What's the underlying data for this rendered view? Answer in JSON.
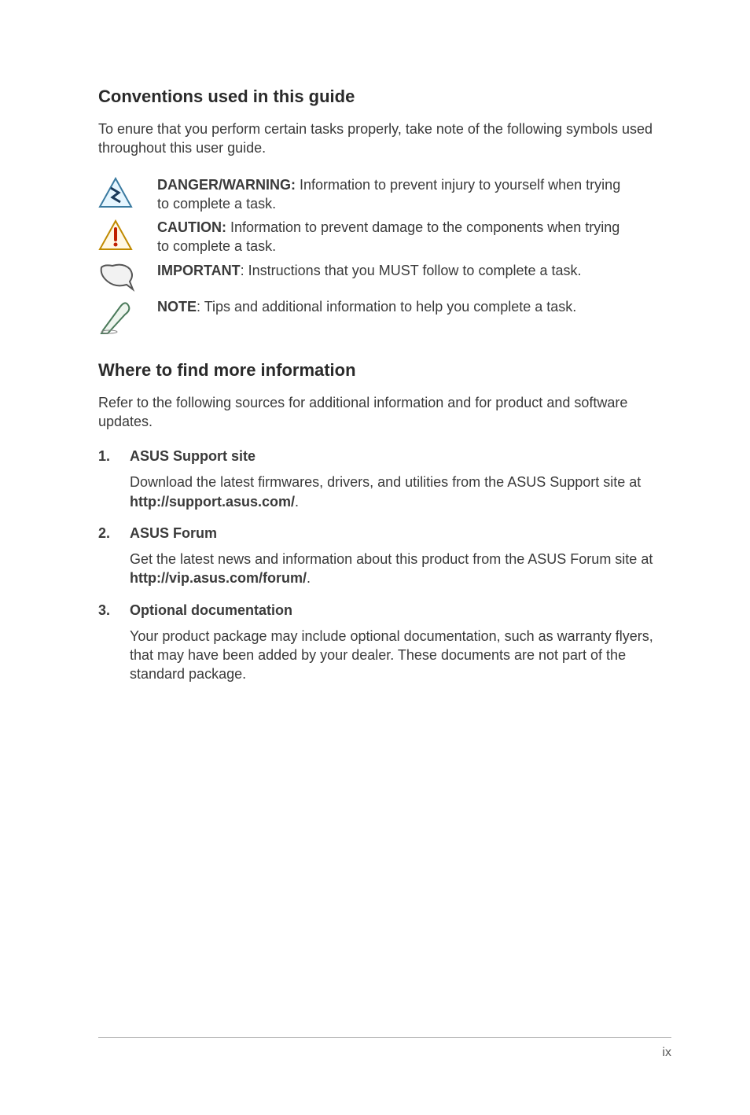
{
  "section1": {
    "heading": "Conventions used in this guide",
    "lead": "To enure that you perform certain tasks properly, take note of the following symbols used throughout this user guide.",
    "items": [
      {
        "label": "DANGER/WARNING:",
        "body": " Information to prevent injury to yourself when trying to complete a task."
      },
      {
        "label": "CAUTION:",
        "body": " Information to prevent damage to the components when trying to complete a task."
      },
      {
        "label": "IMPORTANT",
        "body": ": Instructions that you MUST follow to complete a task."
      },
      {
        "label": "NOTE",
        "body": ": Tips and additional information to help you complete a task."
      }
    ]
  },
  "section2": {
    "heading": "Where to find more information",
    "lead": "Refer to the following sources for additional information and for product and software updates.",
    "items": [
      {
        "title": "ASUS Support site",
        "body_pre": "Download the latest firmwares, drivers, and utilities from the ASUS Support site at ",
        "body_bold": "http://support.asus.com/",
        "body_post": "."
      },
      {
        "title": "ASUS Forum",
        "body_pre": "Get the latest news and information about this product from the ASUS Forum site at ",
        "body_bold": "http://vip.asus.com/forum/",
        "body_post": "."
      },
      {
        "title": "Optional documentation",
        "body_pre": "Your product package may include optional documentation, such as warranty flyers, that may have been added by your dealer. These documents are not part of the standard package.",
        "body_bold": "",
        "body_post": ""
      }
    ]
  },
  "page_number": "ix"
}
